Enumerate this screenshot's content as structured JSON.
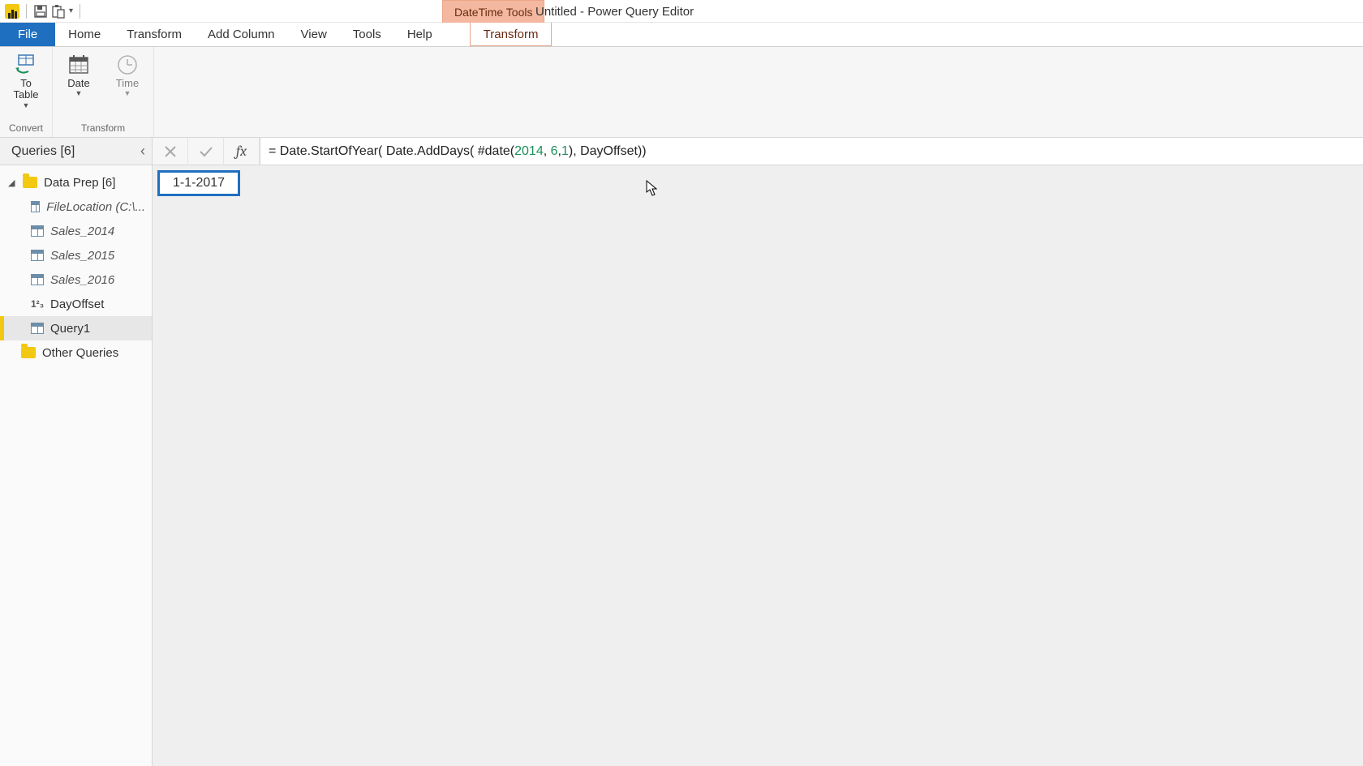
{
  "titlebar": {
    "context_tools_label": "DateTime Tools",
    "window_title": "Untitled - Power Query Editor"
  },
  "menu": {
    "file": "File",
    "items": [
      "Home",
      "Transform",
      "Add Column",
      "View",
      "Tools",
      "Help"
    ],
    "context_tab": "Transform"
  },
  "ribbon": {
    "groups": [
      {
        "name": "Convert",
        "buttons": [
          {
            "label": "To\nTable",
            "dropdown": true,
            "icon": "to-table"
          }
        ]
      },
      {
        "name": "Transform",
        "buttons": [
          {
            "label": "Date",
            "dropdown": true,
            "icon": "date"
          },
          {
            "label": "Time",
            "dropdown": true,
            "icon": "time"
          }
        ]
      }
    ]
  },
  "formula": {
    "prefix": "= Date.StartOfYear( Date.AddDays( #date(",
    "n1": "2014",
    "sep1": ", ",
    "n2": "6",
    "sep2": ",",
    "n3": "1",
    "suffix": "), DayOffset))"
  },
  "queries": {
    "header": "Queries [6]",
    "group1": {
      "label": "Data Prep [6]",
      "items": [
        {
          "icon": "table",
          "label": "FileLocation (C:\\...",
          "italic": true
        },
        {
          "icon": "table",
          "label": "Sales_2014",
          "italic": true
        },
        {
          "icon": "table",
          "label": "Sales_2015",
          "italic": true
        },
        {
          "icon": "table",
          "label": "Sales_2016",
          "italic": true
        },
        {
          "icon": "number",
          "label": "DayOffset",
          "italic": false
        },
        {
          "icon": "table",
          "label": "Query1",
          "italic": false,
          "selected": true
        }
      ]
    },
    "group2": {
      "label": "Other Queries"
    }
  },
  "result_value": "1-1-2017"
}
